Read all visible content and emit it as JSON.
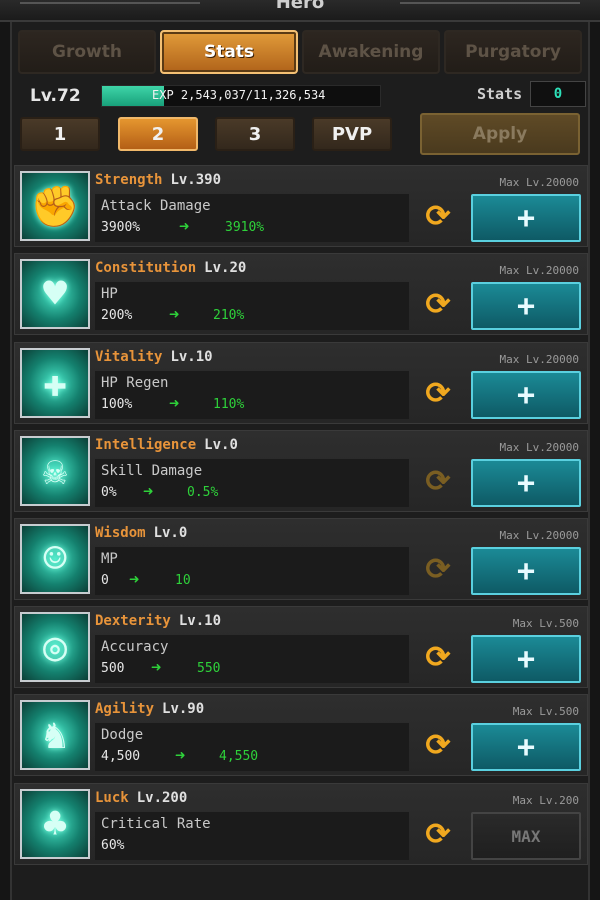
{
  "header": {
    "title": "Hero"
  },
  "tabs": [
    {
      "label": "Growth",
      "state": "dim"
    },
    {
      "label": "Stats",
      "state": "active"
    },
    {
      "label": "Awakening",
      "state": "dim"
    },
    {
      "label": "Purgatory",
      "state": "dim"
    }
  ],
  "level": {
    "label": "Lv.72"
  },
  "exp": {
    "text": "EXP 2,543,037/11,326,534",
    "current": 2543037,
    "max": 11326534
  },
  "stats_points": {
    "label": "Stats",
    "value": "0"
  },
  "presets": [
    {
      "label": "1",
      "active": false
    },
    {
      "label": "2",
      "active": true
    },
    {
      "label": "3",
      "active": false
    },
    {
      "label": "PVP",
      "active": false
    }
  ],
  "apply_label": "Apply",
  "rows": [
    {
      "name": "Strength",
      "level": "Lv.390",
      "max": "Max Lv.20000",
      "stat": "Attack Damage",
      "current": "3900%",
      "next": "3910%",
      "icon": "fist-icon",
      "reset_enabled": true,
      "button": "+"
    },
    {
      "name": "Constitution",
      "level": "Lv.20",
      "max": "Max Lv.20000",
      "stat": "HP",
      "current": "200%",
      "next": "210%",
      "icon": "body-icon",
      "reset_enabled": true,
      "button": "+"
    },
    {
      "name": "Vitality",
      "level": "Lv.10",
      "max": "Max Lv.20000",
      "stat": "HP Regen",
      "current": "100%",
      "next": "110%",
      "icon": "heal-cross-icon",
      "reset_enabled": true,
      "button": "+"
    },
    {
      "name": "Intelligence",
      "level": "Lv.0",
      "max": "Max Lv.20000",
      "stat": "Skill Damage",
      "current": "0%",
      "next": "0.5%",
      "icon": "demon-mask-icon",
      "reset_enabled": false,
      "button": "+"
    },
    {
      "name": "Wisdom",
      "level": "Lv.0",
      "max": "Max Lv.20000",
      "stat": "MP",
      "current": "0",
      "next": "10",
      "icon": "head-icon",
      "reset_enabled": false,
      "button": "+"
    },
    {
      "name": "Dexterity",
      "level": "Lv.10",
      "max": "Max Lv.500",
      "stat": "Accuracy",
      "current": "500",
      "next": "550",
      "icon": "target-icon",
      "reset_enabled": true,
      "button": "+"
    },
    {
      "name": "Agility",
      "level": "Lv.90",
      "max": "Max Lv.500",
      "stat": "Dodge",
      "current": "4,500",
      "next": "4,550",
      "icon": "speed-figure-icon",
      "reset_enabled": true,
      "button": "+"
    },
    {
      "name": "Luck",
      "level": "Lv.200",
      "max": "Max Lv.200",
      "stat": "Critical Rate",
      "current": "60%",
      "next": "",
      "icon": "clover-icon",
      "reset_enabled": true,
      "button": "MAX"
    }
  ]
}
